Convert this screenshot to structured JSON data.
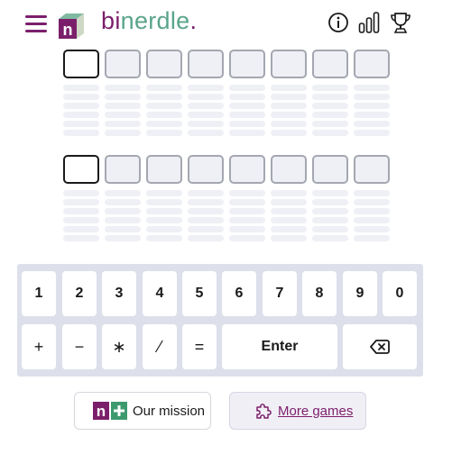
{
  "header": {
    "brand_part1": "bi",
    "brand_part2": "nerdle",
    "brand_dot": ".",
    "logo_letter": "n",
    "icons": [
      "menu-icon",
      "info-icon",
      "stats-icon",
      "trophy-icon"
    ]
  },
  "board": {
    "grids": 2,
    "columns": 8,
    "active_tile": "first tile of each grid"
  },
  "keyboard": {
    "digits": [
      "1",
      "2",
      "3",
      "4",
      "5",
      "6",
      "7",
      "8",
      "9",
      "0"
    ],
    "operators": [
      "+",
      "−",
      "∗",
      "⁄",
      "="
    ],
    "enter_label": "Enter",
    "backspace_icon": "backspace-icon"
  },
  "footer": {
    "mission_label": "Our mission",
    "more_games_label": "More games",
    "mission_icon": "nerdle-plus-logo-icon",
    "games_icon": "puzzle-icon"
  },
  "colors": {
    "brand_purple": "#7b1f6b",
    "brand_green": "#5aa58a",
    "tile_bg": "#eef0f6",
    "tile_border": "#a4a7b0",
    "keyboard_bg": "#dde0eb"
  }
}
